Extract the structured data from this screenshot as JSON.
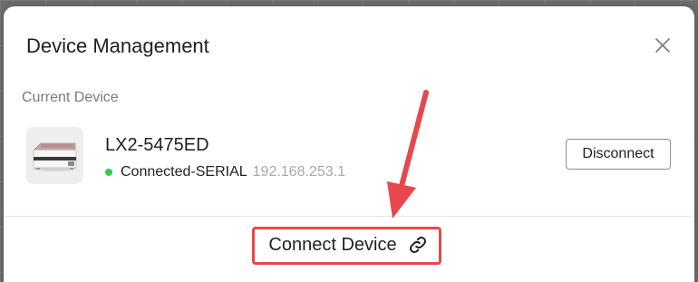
{
  "dialog": {
    "title": "Device Management",
    "close_icon": "close-icon"
  },
  "current_device": {
    "section_label": "Current Device",
    "thumbnail_icon": "laser-engraver-icon",
    "name": "LX2-5475ED",
    "status_text": "Connected-SERIAL",
    "ip_address": "192.168.253.1",
    "status_color": "#3cc75a",
    "disconnect_label": "Disconnect"
  },
  "footer": {
    "connect_label": "Connect Device",
    "connect_icon": "link-icon"
  },
  "annotation": {
    "color": "#e8474b"
  }
}
